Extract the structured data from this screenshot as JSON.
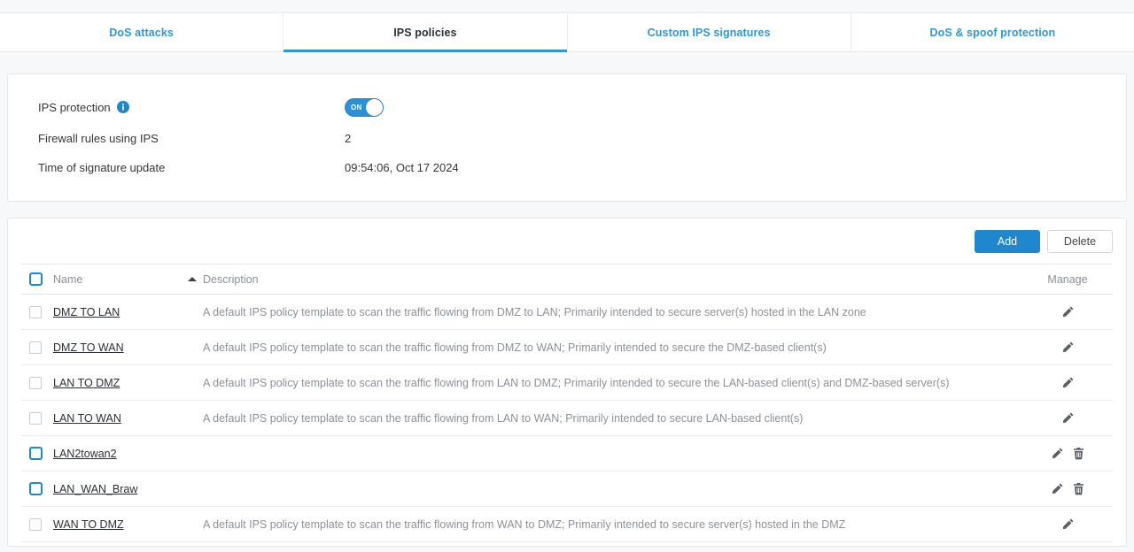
{
  "tabs": [
    {
      "label": "DoS attacks",
      "active": false
    },
    {
      "label": "IPS policies",
      "active": true
    },
    {
      "label": "Custom IPS signatures",
      "active": false
    },
    {
      "label": "DoS & spoof protection",
      "active": false
    }
  ],
  "settings": {
    "rows": [
      {
        "label": "IPS protection",
        "value": "",
        "control": "toggle",
        "info_icon": "info-icon"
      },
      {
        "label": "Firewall rules using IPS",
        "value": "2",
        "control": "text"
      },
      {
        "label": "Time of signature update",
        "value": "09:54:06, Oct 17 2024",
        "control": "text"
      }
    ],
    "toggle_state": "ON"
  },
  "toolbar": {
    "add_label": "Add",
    "delete_label": "Delete"
  },
  "table": {
    "headers": {
      "name": "Name",
      "description": "Description",
      "manage": "Manage"
    },
    "sort": {
      "column": "Name",
      "direction": "ascending",
      "icon": "sort-ascending-icon"
    },
    "rows": [
      {
        "name": "DMZ TO LAN",
        "description": "A default IPS policy template to scan the traffic flowing from DMZ to LAN; Primarily intended to secure server(s) hosted in the LAN zone",
        "checkbox": "disabled",
        "actions": [
          "edit"
        ]
      },
      {
        "name": "DMZ TO WAN",
        "description": "A default IPS policy template to scan the traffic flowing from DMZ to WAN; Primarily intended to secure the DMZ-based client(s)",
        "checkbox": "disabled",
        "actions": [
          "edit"
        ]
      },
      {
        "name": "LAN TO DMZ",
        "description": "A default IPS policy template to scan the traffic flowing from LAN to DMZ; Primarily intended to secure the LAN-based client(s) and DMZ-based server(s)",
        "checkbox": "disabled",
        "actions": [
          "edit"
        ]
      },
      {
        "name": "LAN TO WAN",
        "description": "A default IPS policy template to scan the traffic flowing from LAN to WAN; Primarily intended to secure LAN-based client(s)",
        "checkbox": "disabled",
        "actions": [
          "edit"
        ]
      },
      {
        "name": "LAN2towan2",
        "description": "",
        "checkbox": "enabled",
        "actions": [
          "edit",
          "delete"
        ]
      },
      {
        "name": "LAN_WAN_Braw",
        "description": "",
        "checkbox": "enabled",
        "actions": [
          "edit",
          "delete"
        ]
      },
      {
        "name": "WAN TO DMZ",
        "description": "A default IPS policy template to scan the traffic flowing from WAN to DMZ; Primarily intended to secure server(s) hosted in the DMZ",
        "checkbox": "disabled",
        "actions": [
          "edit"
        ]
      }
    ]
  },
  "colors": {
    "accent": "#2f97d8",
    "primary_button": "#1e87cd",
    "toggle_on": "#2b90d4",
    "page_background": "#f7f8f9",
    "panel": "#ffffff",
    "text": "#33383d",
    "muted_text": "#8c9298"
  }
}
